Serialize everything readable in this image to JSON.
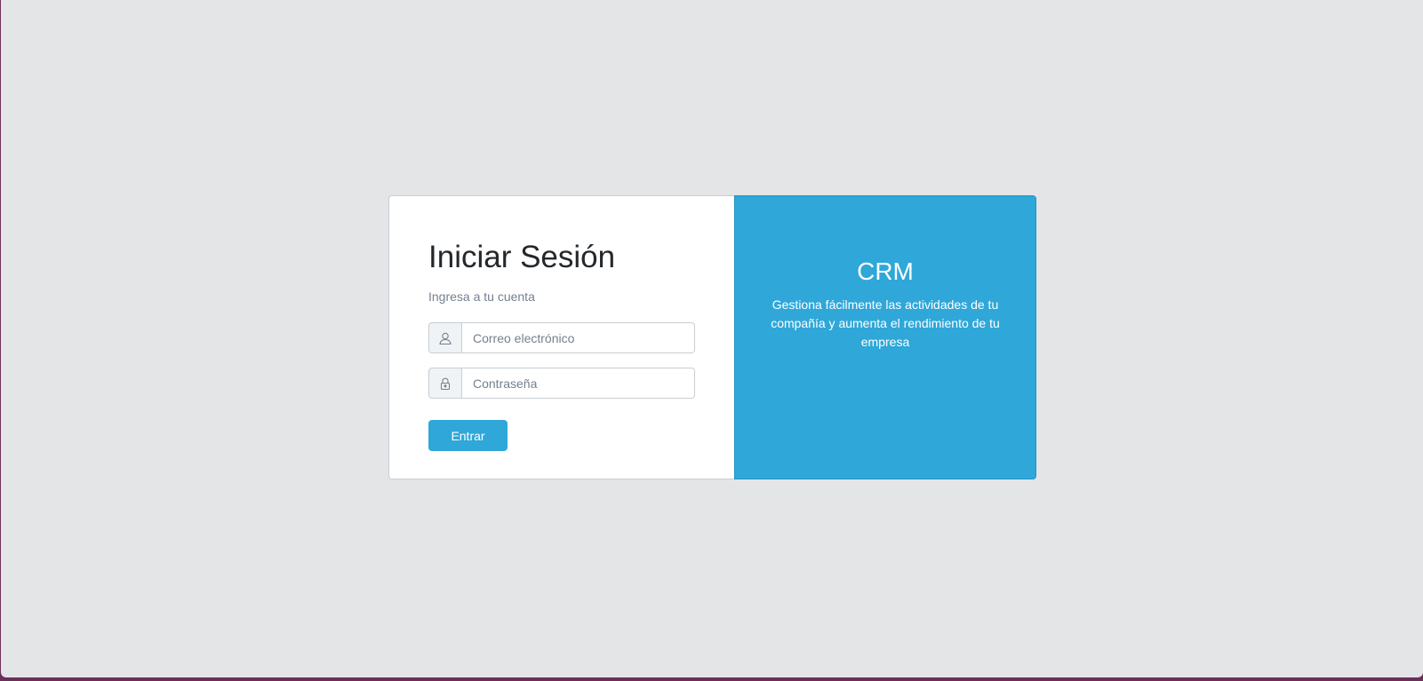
{
  "login": {
    "title": "Iniciar Sesión",
    "subtitle": "Ingresa a tu cuenta",
    "email": {
      "placeholder": "Correo electrónico",
      "value": "",
      "icon": "user-icon"
    },
    "password": {
      "placeholder": "Contraseña",
      "value": "",
      "icon": "lock-icon"
    },
    "submit_label": "Entrar"
  },
  "info": {
    "title": "CRM",
    "description": "Gestiona fácilmente las actividades de tu compañía y aumenta el rendimiento de tu empresa"
  },
  "colors": {
    "accent": "#2fa7d9",
    "page_background": "#e4e5e7",
    "card_background": "#ffffff",
    "title_text": "#23282c",
    "muted_text": "#73818f"
  }
}
